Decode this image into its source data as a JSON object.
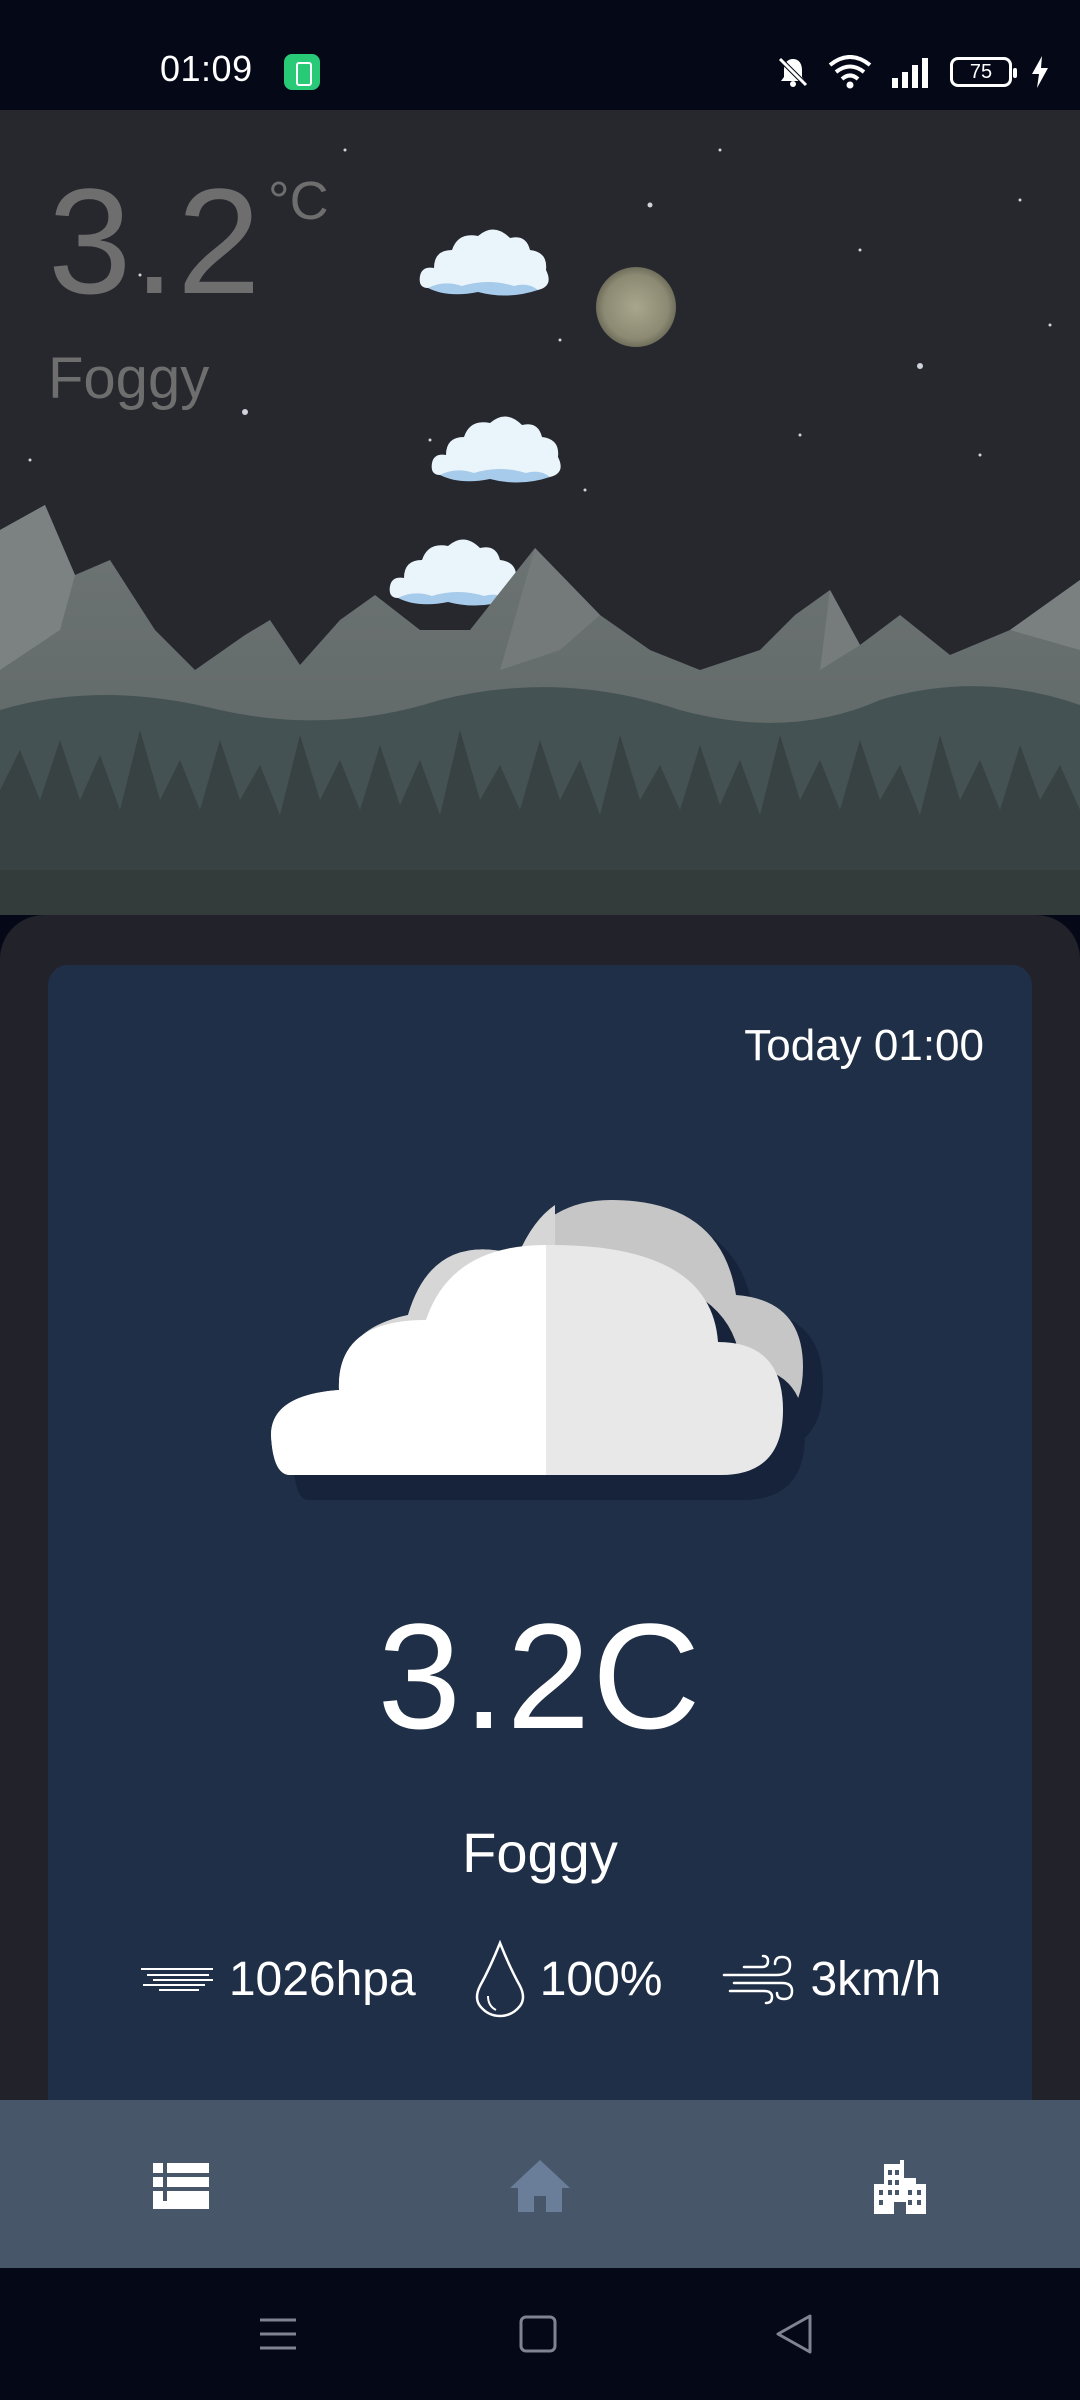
{
  "status_bar": {
    "time": "01:09",
    "battery_level": "75"
  },
  "hero": {
    "temperature": "3.2",
    "unit": "°C",
    "condition": "Foggy"
  },
  "card": {
    "time_label": "Today 01:00",
    "temperature": "3.2C",
    "condition": "Foggy",
    "pressure": "1026hpa",
    "humidity": "100%",
    "wind": "3km/h"
  },
  "nav": {
    "items": [
      "list-icon",
      "home-icon",
      "city-icon"
    ],
    "active": "home-icon"
  },
  "colors": {
    "sky": "#27272e",
    "card_bg": "#1f2f47",
    "card_frame": "#22222b",
    "nav_bg": "#485669",
    "system_bg": "#050817"
  }
}
